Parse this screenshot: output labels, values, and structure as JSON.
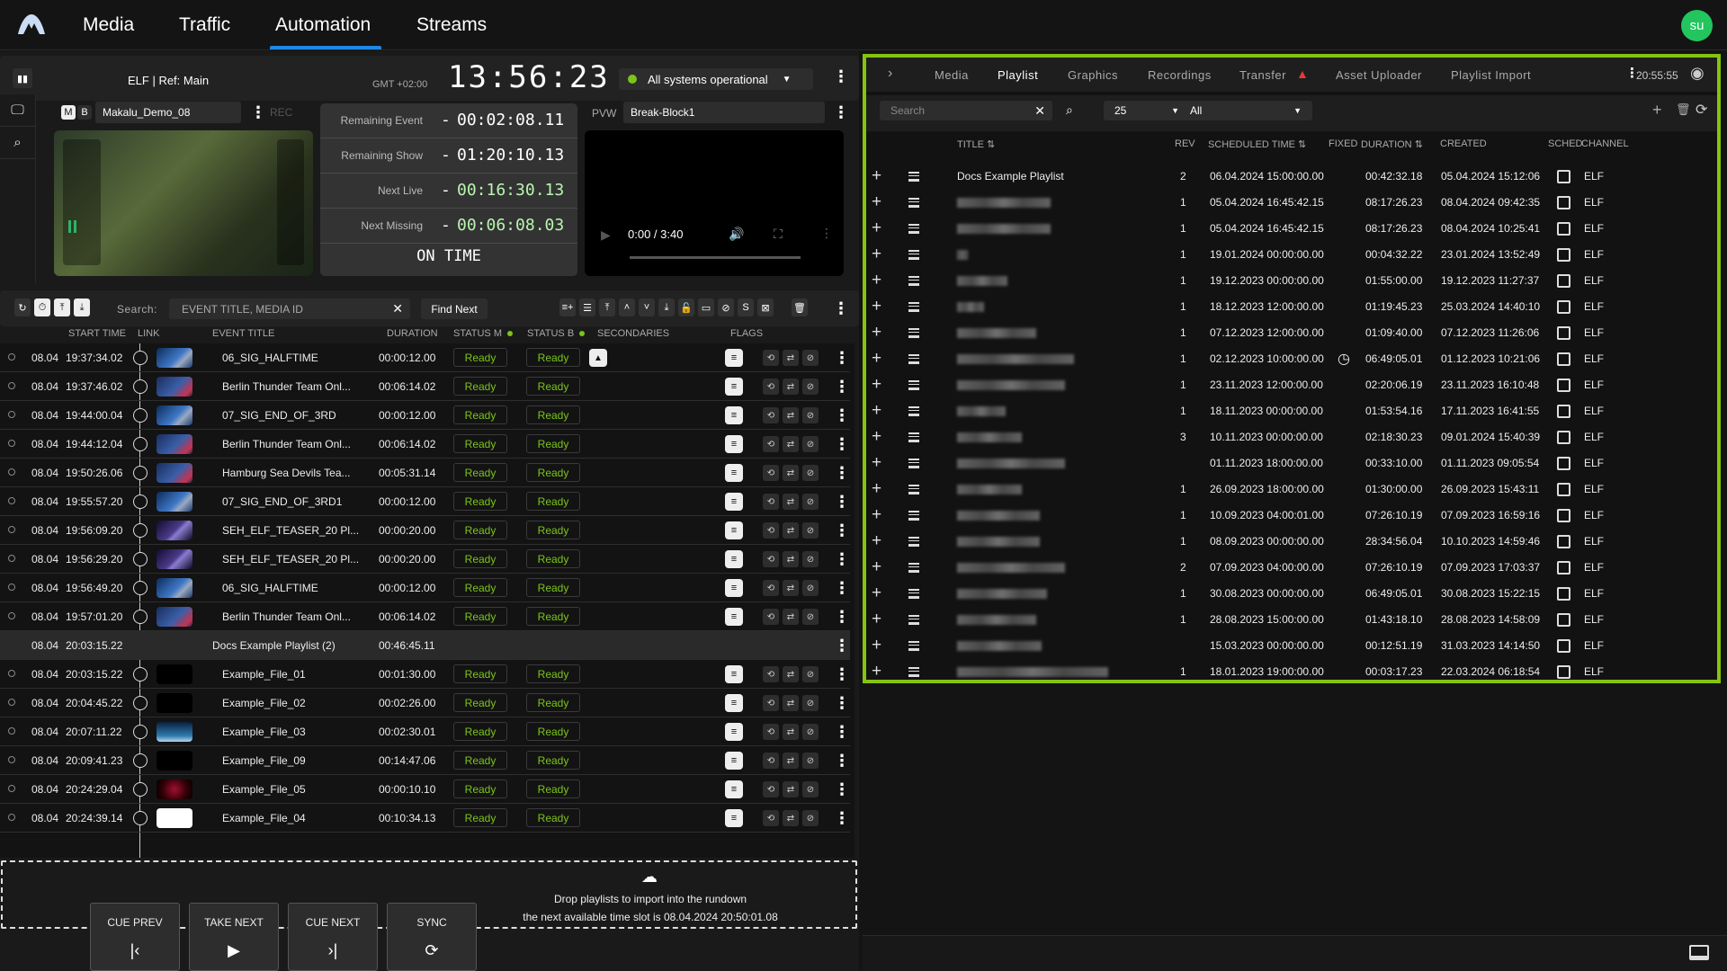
{
  "nav": {
    "tabs": [
      {
        "label": "Media"
      },
      {
        "label": "Traffic"
      },
      {
        "label": "Automation",
        "active": true
      },
      {
        "label": "Streams"
      }
    ],
    "user_initials": "su",
    "accent_color": "#1e88e5"
  },
  "channel_header": {
    "title": "ELF | Ref: Main",
    "timezone": "GMT +02:00",
    "clock": "13:56:23",
    "system_status": "All systems operational",
    "status_color": "#7cc41b"
  },
  "program": {
    "m_label": "M",
    "b_label": "B",
    "clip_name": "Makalu_Demo_08",
    "rec_label": "REC"
  },
  "timers": {
    "rows": [
      {
        "label": "Remaining Event",
        "sign": "-",
        "value": "00:02:08.11"
      },
      {
        "label": "Remaining Show",
        "sign": "-",
        "value": "01:20:10.13"
      },
      {
        "label": "Next Live",
        "sign": "-",
        "value": "00:16:30.13"
      },
      {
        "label": "Next Missing",
        "sign": "-",
        "value": "00:06:08.03"
      }
    ],
    "status": "ON TIME"
  },
  "preview": {
    "label": "PVW",
    "clip_name": "Break-Block1",
    "time": "0:00 / 3:40",
    "progress_fraction": 0
  },
  "toolbar": {
    "search_label": "Search:",
    "search_placeholder": "EVENT TITLE, MEDIA ID",
    "find_next": "Find Next"
  },
  "rundown": {
    "columns": [
      "START TIME",
      "LINK",
      "EVENT TITLE",
      "DURATION",
      "STATUS M",
      "STATUS B",
      "SECONDARIES",
      "FLAGS"
    ],
    "rows": [
      {
        "date": "08.04",
        "time": "19:37:34.02",
        "title": "06_SIG_HALFTIME",
        "duration": "00:00:12.00",
        "status_m": "Ready",
        "status_b": "Ready",
        "thumb": "blue",
        "secondary": true
      },
      {
        "date": "08.04",
        "time": "19:37:46.02",
        "title": "Berlin Thunder Team Onl...",
        "duration": "00:06:14.02",
        "status_m": "Ready",
        "status_b": "Ready",
        "thumb": "bluered"
      },
      {
        "date": "08.04",
        "time": "19:44:00.04",
        "title": "07_SIG_END_OF_3RD",
        "duration": "00:00:12.00",
        "status_m": "Ready",
        "status_b": "Ready",
        "thumb": "blue"
      },
      {
        "date": "08.04",
        "time": "19:44:12.04",
        "title": "Berlin Thunder Team Onl...",
        "duration": "00:06:14.02",
        "status_m": "Ready",
        "status_b": "Ready",
        "thumb": "bluered"
      },
      {
        "date": "08.04",
        "time": "19:50:26.06",
        "title": "Hamburg Sea Devils Tea...",
        "duration": "00:05:31.14",
        "status_m": "Ready",
        "status_b": "Ready",
        "thumb": "bluered"
      },
      {
        "date": "08.04",
        "time": "19:55:57.20",
        "title": "07_SIG_END_OF_3RD1",
        "duration": "00:00:12.00",
        "status_m": "Ready",
        "status_b": "Ready",
        "thumb": "blue"
      },
      {
        "date": "08.04",
        "time": "19:56:09.20",
        "title": "SEH_ELF_TEASER_20 Pl...",
        "duration": "00:00:20.00",
        "status_m": "Ready",
        "status_b": "Ready",
        "thumb": "purple"
      },
      {
        "date": "08.04",
        "time": "19:56:29.20",
        "title": "SEH_ELF_TEASER_20 Pl...",
        "duration": "00:00:20.00",
        "status_m": "Ready",
        "status_b": "Ready",
        "thumb": "purple"
      },
      {
        "date": "08.04",
        "time": "19:56:49.20",
        "title": "06_SIG_HALFTIME",
        "duration": "00:00:12.00",
        "status_m": "Ready",
        "status_b": "Ready",
        "thumb": "blue"
      },
      {
        "date": "08.04",
        "time": "19:57:01.20",
        "title": "Berlin Thunder Team Onl...",
        "duration": "00:06:14.02",
        "status_m": "Ready",
        "status_b": "Ready",
        "thumb": "bluered"
      },
      {
        "group": true,
        "date": "08.04",
        "time": "20:03:15.22",
        "title": "Docs Example Playlist (2)",
        "duration": "00:46:45.11"
      },
      {
        "date": "08.04",
        "time": "20:03:15.22",
        "title": "Example_File_01",
        "duration": "00:01:30.00",
        "status_m": "Ready",
        "status_b": "Ready",
        "thumb": "black"
      },
      {
        "date": "08.04",
        "time": "20:04:45.22",
        "title": "Example_File_02",
        "duration": "00:02:26.00",
        "status_m": "Ready",
        "status_b": "Ready",
        "thumb": "black"
      },
      {
        "date": "08.04",
        "time": "20:07:11.22",
        "title": "Example_File_03",
        "duration": "00:02:30.01",
        "status_m": "Ready",
        "status_b": "Ready",
        "thumb": "sky"
      },
      {
        "date": "08.04",
        "time": "20:09:41.23",
        "title": "Example_File_09",
        "duration": "00:14:47.06",
        "status_m": "Ready",
        "status_b": "Ready",
        "thumb": "black"
      },
      {
        "date": "08.04",
        "time": "20:24:29.04",
        "title": "Example_File_05",
        "duration": "00:00:10.10",
        "status_m": "Ready",
        "status_b": "Ready",
        "thumb": "red"
      },
      {
        "date": "08.04",
        "time": "20:24:39.14",
        "title": "Example_File_04",
        "duration": "00:10:34.13",
        "status_m": "Ready",
        "status_b": "Ready",
        "thumb": "white"
      }
    ]
  },
  "dropzone": {
    "line1": "Drop playlists to import into the rundown",
    "line2": "the next available time slot is 08.04.2024 20:50:01.08"
  },
  "controls": [
    {
      "label": "CUE PREV",
      "icon": "cue-prev-icon",
      "glyph": "|‹"
    },
    {
      "label": "TAKE NEXT",
      "icon": "play-icon",
      "glyph": "▶"
    },
    {
      "label": "CUE NEXT",
      "icon": "cue-next-icon",
      "glyph": "›|"
    },
    {
      "label": "SYNC",
      "icon": "sync-icon",
      "glyph": "⟳"
    }
  ],
  "right_panel": {
    "tabs": [
      {
        "label": "Media"
      },
      {
        "label": "Playlist",
        "active": true
      },
      {
        "label": "Graphics"
      },
      {
        "label": "Recordings"
      },
      {
        "label": "Transfer",
        "warning": true
      },
      {
        "label": "Asset Uploader"
      },
      {
        "label": "Playlist Import"
      }
    ],
    "clock": "20:55:55",
    "search_placeholder": "Search",
    "page_size": "25",
    "filter": "All",
    "columns": [
      "TITLE",
      "REV",
      "SCHEDULED TIME",
      "FIXED",
      "DURATION",
      "CREATED",
      "SCHED",
      "CHANNEL"
    ],
    "rows": [
      {
        "title": "Docs Example Playlist",
        "blurred": false,
        "rev": "2",
        "scheduled": "06.04.2024 15:00:00.00",
        "fixed": false,
        "duration": "00:42:32.18",
        "created": "05.04.2024 15:12:06",
        "sched": false,
        "channel": "ELF"
      },
      {
        "title": "",
        "blurred": true,
        "rev": "1",
        "scheduled": "05.04.2024 16:45:42.15",
        "fixed": false,
        "duration": "08:17:26.23",
        "created": "08.04.2024 09:42:35",
        "sched": false,
        "channel": "ELF"
      },
      {
        "title": "",
        "blurred": true,
        "rev": "1",
        "scheduled": "05.04.2024 16:45:42.15",
        "fixed": false,
        "duration": "08:17:26.23",
        "created": "08.04.2024 10:25:41",
        "sched": false,
        "channel": "ELF"
      },
      {
        "title": "",
        "blurred": true,
        "rev": "1",
        "scheduled": "19.01.2024 00:00:00.00",
        "fixed": false,
        "duration": "00:04:32.22",
        "created": "23.01.2024 13:52:49",
        "sched": false,
        "channel": "ELF"
      },
      {
        "title": "",
        "blurred": true,
        "rev": "1",
        "scheduled": "19.12.2023 00:00:00.00",
        "fixed": false,
        "duration": "01:55:00.00",
        "created": "19.12.2023 11:27:37",
        "sched": false,
        "channel": "ELF"
      },
      {
        "title": "",
        "blurred": true,
        "rev": "1",
        "scheduled": "18.12.2023 12:00:00.00",
        "fixed": false,
        "duration": "01:19:45.23",
        "created": "25.03.2024 14:40:10",
        "sched": false,
        "channel": "ELF"
      },
      {
        "title": "",
        "blurred": true,
        "rev": "1",
        "scheduled": "07.12.2023 12:00:00.00",
        "fixed": false,
        "duration": "01:09:40.00",
        "created": "07.12.2023 11:26:06",
        "sched": false,
        "channel": "ELF"
      },
      {
        "title": "",
        "blurred": true,
        "rev": "1",
        "scheduled": "02.12.2023 10:00:00.00",
        "fixed": true,
        "duration": "06:49:05.01",
        "created": "01.12.2023 10:21:06",
        "sched": false,
        "channel": "ELF"
      },
      {
        "title": "",
        "blurred": true,
        "rev": "1",
        "scheduled": "23.11.2023 12:00:00.00",
        "fixed": false,
        "duration": "02:20:06.19",
        "created": "23.11.2023 16:10:48",
        "sched": false,
        "channel": "ELF"
      },
      {
        "title": "",
        "blurred": true,
        "rev": "1",
        "scheduled": "18.11.2023 00:00:00.00",
        "fixed": false,
        "duration": "01:53:54.16",
        "created": "17.11.2023 16:41:55",
        "sched": false,
        "channel": "ELF"
      },
      {
        "title": "",
        "blurred": true,
        "rev": "3",
        "scheduled": "10.11.2023 00:00:00.00",
        "fixed": false,
        "duration": "02:18:30.23",
        "created": "09.01.2024 15:40:39",
        "sched": false,
        "channel": "ELF"
      },
      {
        "title": "",
        "blurred": true,
        "rev": "",
        "scheduled": "01.11.2023 18:00:00.00",
        "fixed": false,
        "duration": "00:33:10.00",
        "created": "01.11.2023 09:05:54",
        "sched": false,
        "channel": "ELF"
      },
      {
        "title": "",
        "blurred": true,
        "rev": "1",
        "scheduled": "26.09.2023 18:00:00.00",
        "fixed": false,
        "duration": "01:30:00.00",
        "created": "26.09.2023 15:43:11",
        "sched": false,
        "channel": "ELF"
      },
      {
        "title": "",
        "blurred": true,
        "rev": "1",
        "scheduled": "10.09.2023 04:00:01.00",
        "fixed": false,
        "duration": "07:26:10.19",
        "created": "07.09.2023 16:59:16",
        "sched": false,
        "channel": "ELF"
      },
      {
        "title": "",
        "blurred": true,
        "rev": "1",
        "scheduled": "08.09.2023 00:00:00.00",
        "fixed": false,
        "duration": "28:34:56.04",
        "created": "10.10.2023 14:59:46",
        "sched": false,
        "channel": "ELF"
      },
      {
        "title": "",
        "blurred": true,
        "rev": "2",
        "scheduled": "07.09.2023 04:00:00.00",
        "fixed": false,
        "duration": "07:26:10.19",
        "created": "07.09.2023 17:03:37",
        "sched": false,
        "channel": "ELF"
      },
      {
        "title": "",
        "blurred": true,
        "rev": "1",
        "scheduled": "30.08.2023 00:00:00.00",
        "fixed": false,
        "duration": "06:49:05.01",
        "created": "30.08.2023 15:22:15",
        "sched": false,
        "channel": "ELF"
      },
      {
        "title": "",
        "blurred": true,
        "rev": "1",
        "scheduled": "28.08.2023 15:00:00.00",
        "fixed": false,
        "duration": "01:43:18.10",
        "created": "28.08.2023 14:58:09",
        "sched": false,
        "channel": "ELF"
      },
      {
        "title": "",
        "blurred": true,
        "rev": "",
        "scheduled": "15.03.2023 00:00:00.00",
        "fixed": false,
        "duration": "00:12:51.19",
        "created": "31.03.2023 14:14:50",
        "sched": false,
        "channel": "ELF"
      },
      {
        "title": "",
        "blurred": true,
        "rev": "1",
        "scheduled": "18.01.2023 19:00:00.00",
        "fixed": false,
        "duration": "00:03:17.23",
        "created": "22.03.2024 06:18:54",
        "sched": false,
        "channel": "ELF"
      }
    ],
    "border_color": "#84c40f"
  }
}
